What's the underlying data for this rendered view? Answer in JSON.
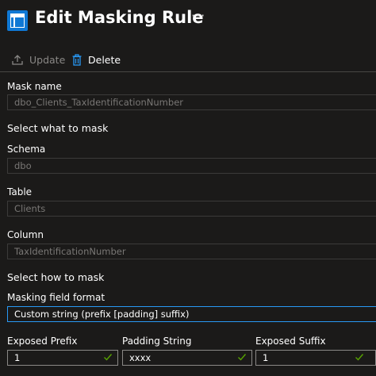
{
  "header": {
    "title": "Edit Masking Rule",
    "more": "···"
  },
  "toolbar": {
    "update_label": "Update",
    "delete_label": "Delete"
  },
  "form": {
    "mask_name": {
      "label": "Mask name",
      "value": "dbo_Clients_TaxIdentificationNumber"
    },
    "select_what": "Select what to mask",
    "schema": {
      "label": "Schema",
      "value": "dbo"
    },
    "table": {
      "label": "Table",
      "value": "Clients"
    },
    "column": {
      "label": "Column",
      "value": "TaxIdentificationNumber"
    },
    "select_how": "Select how to mask",
    "format": {
      "label": "Masking field format",
      "value": "Custom string (prefix [padding] suffix)"
    },
    "exposed_prefix": {
      "label": "Exposed Prefix",
      "value": "1"
    },
    "padding_string": {
      "label": "Padding String",
      "value": "xxxx"
    },
    "exposed_suffix": {
      "label": "Exposed Suffix",
      "value": "1"
    }
  },
  "colors": {
    "background": "#1b1a19",
    "accent": "#0f78d4",
    "focus_border": "#2899f5",
    "valid_check": "#57a300"
  }
}
